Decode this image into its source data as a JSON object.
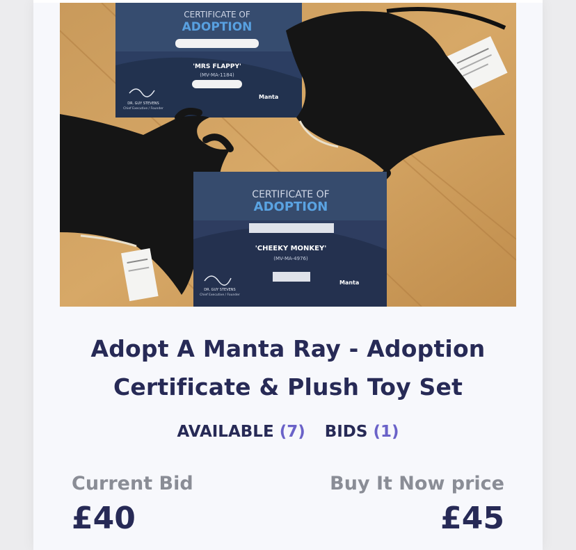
{
  "listing": {
    "title_line1": "Adopt A Manta Ray - Adoption",
    "title_line2": "Certificate & Plush Toy Set",
    "available_label": "AVAILABLE",
    "available_count": "(7)",
    "bids_label": "BIDS",
    "bids_count": "(1)",
    "current_bid_label": "Current Bid",
    "current_bid_value": "£40",
    "buy_now_label": "Buy It Now price",
    "buy_now_value": "£45"
  },
  "photo": {
    "cert1": {
      "heading": "CERTIFICATE OF",
      "subheading": "ADOPTION",
      "name": "'MRS FLAPPY'",
      "code": "(MV-MA-1184)",
      "signer": "DR. GUY STEVENS",
      "signer_role": "Chief Executive / Founder",
      "logo": "Manta"
    },
    "cert2": {
      "heading": "CERTIFICATE OF",
      "subheading": "ADOPTION",
      "name": "'CHEEKY MONKEY'",
      "code": "(MV-MA-4976)",
      "signer": "DR. GUY STEVENS",
      "signer_role": "Chief Executive / Founder",
      "logo": "Manta"
    }
  },
  "colors": {
    "title": "#272a56",
    "count_accent": "#6a62c8",
    "label_gray": "#8a8d96",
    "card_bg": "#f7f8fc"
  }
}
